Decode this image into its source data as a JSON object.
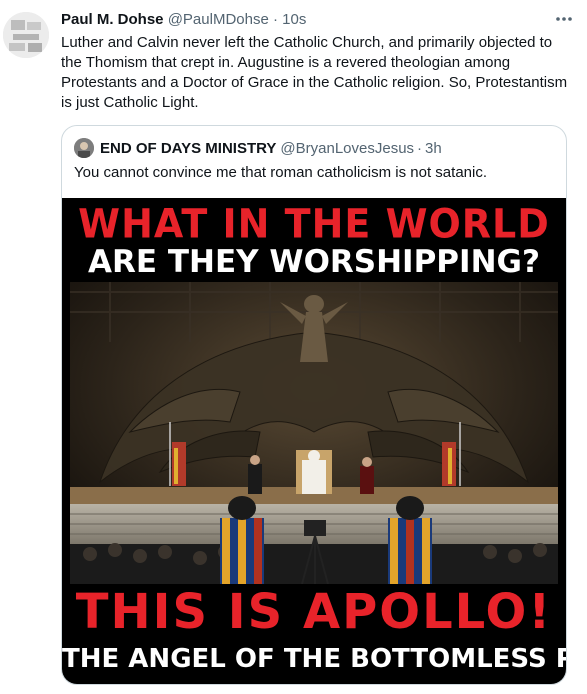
{
  "tweet": {
    "author_name": "Paul M. Dohse",
    "handle": "@PaulMDohse",
    "separator": "·",
    "time": "10s",
    "more_icon": "more-horizontal-icon",
    "text": "Luther and Calvin never left the Catholic Church, and primarily objected to the Thomism that crept in. Augustine is a revered theologian among Protestants and a Doctor of Grace in the Catholic religion. So, Protestantism is just Catholic Light."
  },
  "quoted_tweet": {
    "author_name": "END OF DAYS MINISTRY",
    "handle": "@BryanLovesJesus",
    "separator": "·",
    "time": "3h",
    "text": "You cannot convince me that roman catholicism is not satanic.",
    "media": {
      "line1": "WHAT IN THE WORLD",
      "line2": "ARE THEY WORSHIPPING?",
      "line3": "THIS IS APOLLO!",
      "line4": "THE ANGEL OF THE BOTTOMLESS PIT!"
    }
  },
  "colors": {
    "meme_red": "#e8232a",
    "meme_white": "#ffffff",
    "secondary_text": "#536471",
    "border": "#cfd9de"
  }
}
